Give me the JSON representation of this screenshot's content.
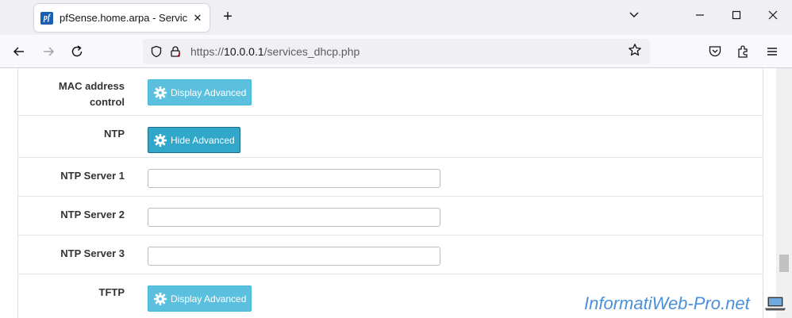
{
  "browser": {
    "tab_title": "pfSense.home.arpa - Services: D",
    "tab_close": "✕",
    "favicon_text": "pf",
    "new_tab": "+",
    "url_prefix": "https://",
    "url_host": "10.0.0.1",
    "url_path": "/services_dhcp.php",
    "icons": [
      "back-icon",
      "forward-icon",
      "reload-icon",
      "shield-icon",
      "lock-icon",
      "star-icon",
      "pocket-icon",
      "extensions-icon",
      "menu-icon"
    ]
  },
  "form": {
    "rows": [
      {
        "label_line1": "MAC address",
        "label_line2": "control",
        "button": "Display Advanced"
      },
      {
        "label": "NTP",
        "button": "Hide Advanced"
      },
      {
        "label": "NTP Server 1",
        "value": ""
      },
      {
        "label": "NTP Server 2",
        "value": ""
      },
      {
        "label": "NTP Server 3",
        "value": ""
      },
      {
        "label": "TFTP",
        "button": "Display Advanced"
      }
    ]
  },
  "colors": {
    "button": "#5bc0de",
    "button_active": "#31a7c9",
    "watermark": "#4a90d9"
  },
  "watermark": "InformatiWeb-Pro.net"
}
